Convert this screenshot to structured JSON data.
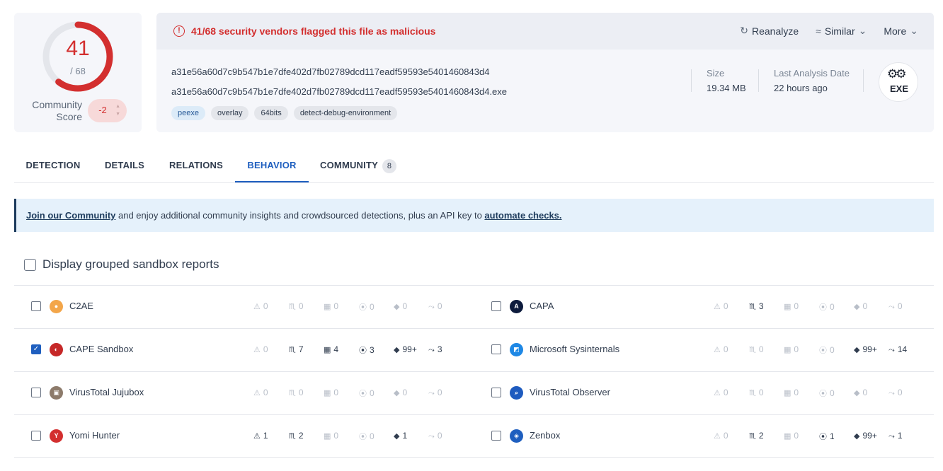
{
  "score": {
    "detections": "41",
    "total": "/ 68",
    "detection_fraction": 0.603,
    "community_label_line1": "Community",
    "community_label_line2": "Score",
    "community_value": "-2",
    "accent": "#d32f2f"
  },
  "alert": {
    "icon": "!",
    "text": "41/68 security vendors flagged this file as malicious"
  },
  "actions": {
    "reanalyze": "Reanalyze",
    "similar": "Similar",
    "more": "More"
  },
  "file": {
    "sha256": "a31e56a60d7c9b547b1e7dfe402d7fb02789dcd117eadf59593e5401460843d4",
    "name": "a31e56a60d7c9b547b1e7dfe402d7fb02789dcd117eadf59593e5401460843d4.exe",
    "tags": [
      "peexe",
      "overlay",
      "64bits",
      "detect-debug-environment"
    ],
    "size_label": "Size",
    "size_value": "19.34 MB",
    "date_label": "Last Analysis Date",
    "date_value": "22 hours ago",
    "type_badge": "EXE"
  },
  "tabs": {
    "detection": "DETECTION",
    "details": "DETAILS",
    "relations": "RELATIONS",
    "behavior": "BEHAVIOR",
    "community": "COMMUNITY",
    "community_count": "8"
  },
  "banner": {
    "link1": "Join our Community",
    "middle": " and enjoy additional community insights and crowdsourced detections, plus an API key to ",
    "link2": "automate checks."
  },
  "grouped": {
    "label": "Display grouped sandbox reports"
  },
  "sandboxes": [
    {
      "name": "C2AE",
      "checked": false,
      "stats": [
        "0",
        "0",
        "0",
        "0",
        "0",
        "0"
      ]
    },
    {
      "name": "CAPA",
      "checked": false,
      "stats": [
        "0",
        "3",
        "0",
        "0",
        "0",
        "0"
      ]
    },
    {
      "name": "CAPE Sandbox",
      "checked": true,
      "stats": [
        "0",
        "7",
        "4",
        "3",
        "99+",
        "3"
      ]
    },
    {
      "name": "Microsoft Sysinternals",
      "checked": false,
      "stats": [
        "0",
        "0",
        "0",
        "0",
        "99+",
        "14"
      ]
    },
    {
      "name": "VirusTotal Jujubox",
      "checked": false,
      "stats": [
        "0",
        "0",
        "0",
        "0",
        "0",
        "0"
      ]
    },
    {
      "name": "VirusTotal Observer",
      "checked": false,
      "stats": [
        "0",
        "0",
        "0",
        "0",
        "0",
        "0"
      ]
    },
    {
      "name": "Yomi Hunter",
      "checked": false,
      "stats": [
        "1",
        "2",
        "0",
        "0",
        "1",
        "0"
      ]
    },
    {
      "name": "Zenbox",
      "checked": false,
      "stats": [
        "0",
        "2",
        "0",
        "1",
        "99+",
        "1"
      ]
    }
  ]
}
